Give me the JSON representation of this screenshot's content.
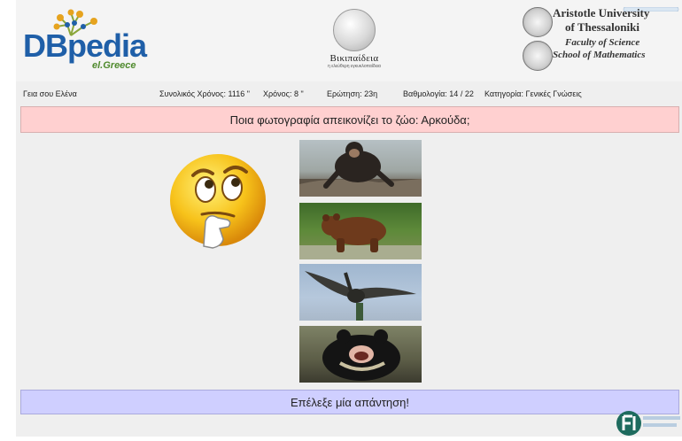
{
  "header": {
    "dbpedia_logo": {
      "word_db": "DB",
      "word_pedia": "pedia",
      "subtitle": "el.Greece"
    },
    "wikipedia_logo": {
      "name": "Βικιπαίδεια",
      "tagline": "η ελεύθερη εγκυκλοπαίδεια"
    },
    "university": {
      "line1": "Aristotle University",
      "line2": "of Thessaloniki",
      "line3": "Faculty of Science",
      "line4": "School of Mathematics"
    }
  },
  "status": {
    "greeting": "Γεια σου Ελένα",
    "total_time": "Συνολικός Χρόνος: 1116 \"",
    "time": "Χρόνος: 8 \"",
    "question_no": "Ερώτηση: 23η",
    "score": "Βαθμολογία: 14 / 22",
    "category": "Κατηγορία: Γενικές Γνώσεις"
  },
  "question": {
    "text": "Ποια φωτογραφία απεικονίζει το ζώο: Αρκούδα;"
  },
  "options": [
    {
      "icon": "chimpanzee-photo"
    },
    {
      "icon": "brown-bear-photo"
    },
    {
      "icon": "bird-photo"
    },
    {
      "icon": "black-bear-photo"
    }
  ],
  "emoji": {
    "icon": "thinking-face-icon"
  },
  "answer_bar": {
    "text": "Επέλεξε μία απάντηση!"
  },
  "colors": {
    "question_bg": "#ffd0d0",
    "answer_bg": "#cfcfff",
    "page_bg": "#efefef"
  }
}
